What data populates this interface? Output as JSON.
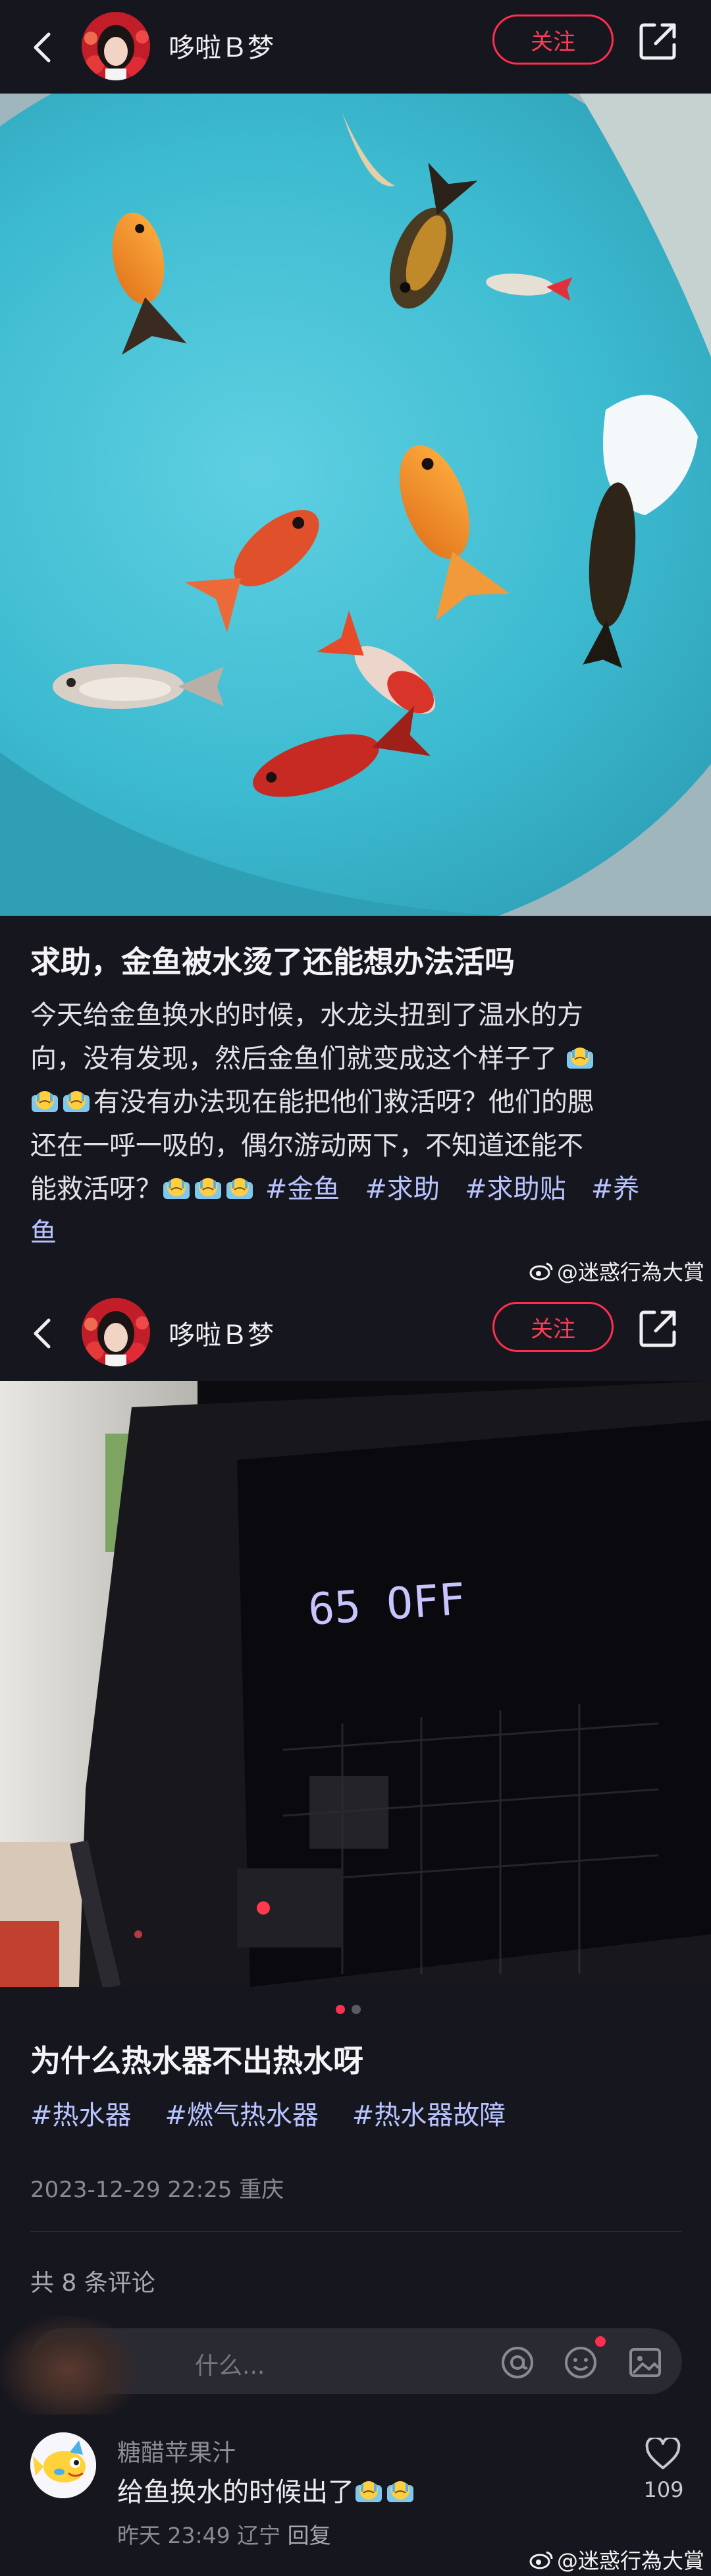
{
  "post1": {
    "header": {
      "username": "哆啦Ｂ梦",
      "follow_label": "关注"
    },
    "title": "求助，金鱼被水烫了还能想办法活吗",
    "body": {
      "line1": "今天给金鱼换水的时候，水龙头扭到了温水的方",
      "line2": "向，没有发现，然后金鱼们就变成这个样子了",
      "line3": "有没有办法现在能把他们救活呀？他们的腮",
      "line4": "还在一呼一吸的，偶尔游动两下，不知道还能不",
      "line5_text": "能救活呀？",
      "tags": [
        "#金鱼",
        "#求助",
        "#求助贴",
        "#养"
      ],
      "line6": "鱼"
    },
    "emoji": "crying-face-emoji"
  },
  "watermark": "@迷惑行為大賞",
  "post2": {
    "header": {
      "username": "哆啦Ｂ梦",
      "follow_label": "关注"
    },
    "display_readout": "65 OFF",
    "title": "为什么热水器不出热水呀",
    "tags": [
      "#热水器",
      "#燃气热水器",
      "#热水器故障"
    ],
    "date_location": "2023-12-29 22:25 重庆",
    "comment_count": "共 8 条评论",
    "comment_placeholder": "什么...",
    "comment": {
      "author": "糖醋苹果汁",
      "text": "给鱼换水的时候出了",
      "time_location": "昨天 23:49 辽宁",
      "reply_label": "回复",
      "likes": "109"
    },
    "carousel": {
      "current": 1,
      "total": 2
    }
  },
  "colors": {
    "accent": "#ff2e4d",
    "tag": "#b8c4ff",
    "background": "#16161e"
  }
}
